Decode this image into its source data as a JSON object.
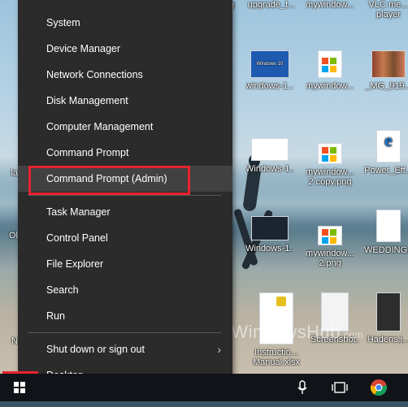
{
  "desktop": {
    "icons": [
      {
        "label": "pg",
        "thumb": "none"
      },
      {
        "label": "upgrade_t...",
        "thumb": "none"
      },
      {
        "label": "mywindow...",
        "thumb": "none"
      },
      {
        "label": "VLC me...",
        "label2": "player",
        "thumb": "none"
      },
      {
        "label": "windows-1...",
        "thumb": "win"
      },
      {
        "label": "mywindow...",
        "thumb": "colors"
      },
      {
        "label": "_MG_919...",
        "thumb": "people"
      },
      {
        "label": "Windows-1...",
        "thumb": "doc"
      },
      {
        "label": "mywindow...",
        "label2": "2 copy.png",
        "thumb": "colors"
      },
      {
        "label": "Power_Eff...",
        "thumb": "edge"
      },
      {
        "label": "Windows-1...",
        "thumb": "dark"
      },
      {
        "label": "mywindow...",
        "label2": "2.png",
        "thumb": "colors"
      },
      {
        "label": "WEDDING...",
        "thumb": "doc"
      },
      {
        "label": "Instructio...",
        "label2": "Manual.xlsx",
        "thumb": "lock"
      },
      {
        "label": "Screenshot...",
        "thumb": "shot"
      },
      {
        "label": "Hadens.j...",
        "thumb": "phone"
      }
    ],
    "left_edge_labels": [
      "la",
      "Ol",
      "N"
    ]
  },
  "context_menu": {
    "items": [
      {
        "label": "System"
      },
      {
        "label": "Device Manager"
      },
      {
        "label": "Network Connections"
      },
      {
        "label": "Disk Management"
      },
      {
        "label": "Computer Management"
      },
      {
        "label": "Command Prompt"
      },
      {
        "label": "Command Prompt (Admin)"
      },
      {
        "label": "Task Manager"
      },
      {
        "label": "Control Panel"
      },
      {
        "label": "File Explorer"
      },
      {
        "label": "Search"
      },
      {
        "label": "Run"
      },
      {
        "label": "Shut down or sign out",
        "chevron": "›"
      },
      {
        "label": "Desktop"
      }
    ],
    "highlighted_item": "Command Prompt (Admin)"
  },
  "watermark": {
    "letters": [
      "M",
      "W"
    ],
    "text": "MyWindowsHub",
    "suffix": ".com"
  },
  "taskbar": {
    "icons": [
      "start-icon",
      "microphone-icon",
      "task-view-icon",
      "chrome-icon"
    ]
  },
  "colors": {
    "menu_bg": "#2b2b2b",
    "highlight_red": "#e8232f",
    "taskbar_bg": "#101418"
  }
}
